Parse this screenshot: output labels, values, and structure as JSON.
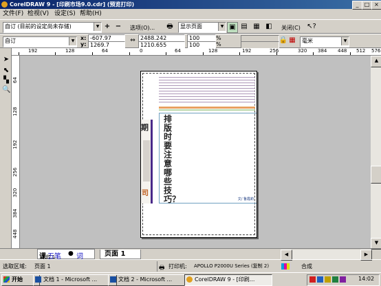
{
  "window": {
    "title": "CorelDRAW 9 - [印刷市场9.0.cdr] (预览打印)"
  },
  "menu": [
    {
      "label": "文件(F)"
    },
    {
      "label": "检视(V)"
    },
    {
      "label": "设定(S)"
    },
    {
      "label": "帮助(H)"
    }
  ],
  "toolbar1": {
    "preset_value": "自订 (目前的设定尚未存储)",
    "add": "+",
    "remove": "−",
    "options_label": "选项(O)...",
    "view_value": "显示页面",
    "close_label": "关闭(C)"
  },
  "toolbar2": {
    "paper_value": "自订",
    "x_label": "x:",
    "x_value": "-607.97",
    "y_label": "y:",
    "y_value": "1269.7",
    "w_value": "2488.242",
    "h_value": "1210.655",
    "scale_x": "100",
    "scale_y": "100",
    "units_value": "毫米"
  },
  "ruler_h": [
    "192",
    "128",
    "64",
    "0",
    "64",
    "128",
    "192",
    "256",
    "320",
    "384",
    "448",
    "512",
    "576"
  ],
  "ruler_v": [
    "64",
    "128",
    "192",
    "256",
    "320",
    "384",
    "448"
  ],
  "document": {
    "left_chars": [
      "期",
      "司"
    ],
    "headline": "排版时要注意哪些技巧？",
    "byline": "文/ 鲁霞莉"
  },
  "pagebar": {
    "page_tab": "页面 1",
    "page_counter": "1 的 1"
  },
  "ime": {
    "mode": "课",
    "method": "五笔",
    "punct": "●",
    "word": "词"
  },
  "status": {
    "area_label": "选取区域:",
    "page_value": "页面 1",
    "printer_label": "打印机:",
    "printer_value": "APOLLO P2000U Series (复制 2)",
    "composite": "合成"
  },
  "taskbar": {
    "start": "开始",
    "tasks": [
      "文档 1 - Microsoft ...",
      "文档 2 - Microsoft ...",
      "CorelDRAW 9 - [印刷..."
    ],
    "time": "14:02"
  }
}
